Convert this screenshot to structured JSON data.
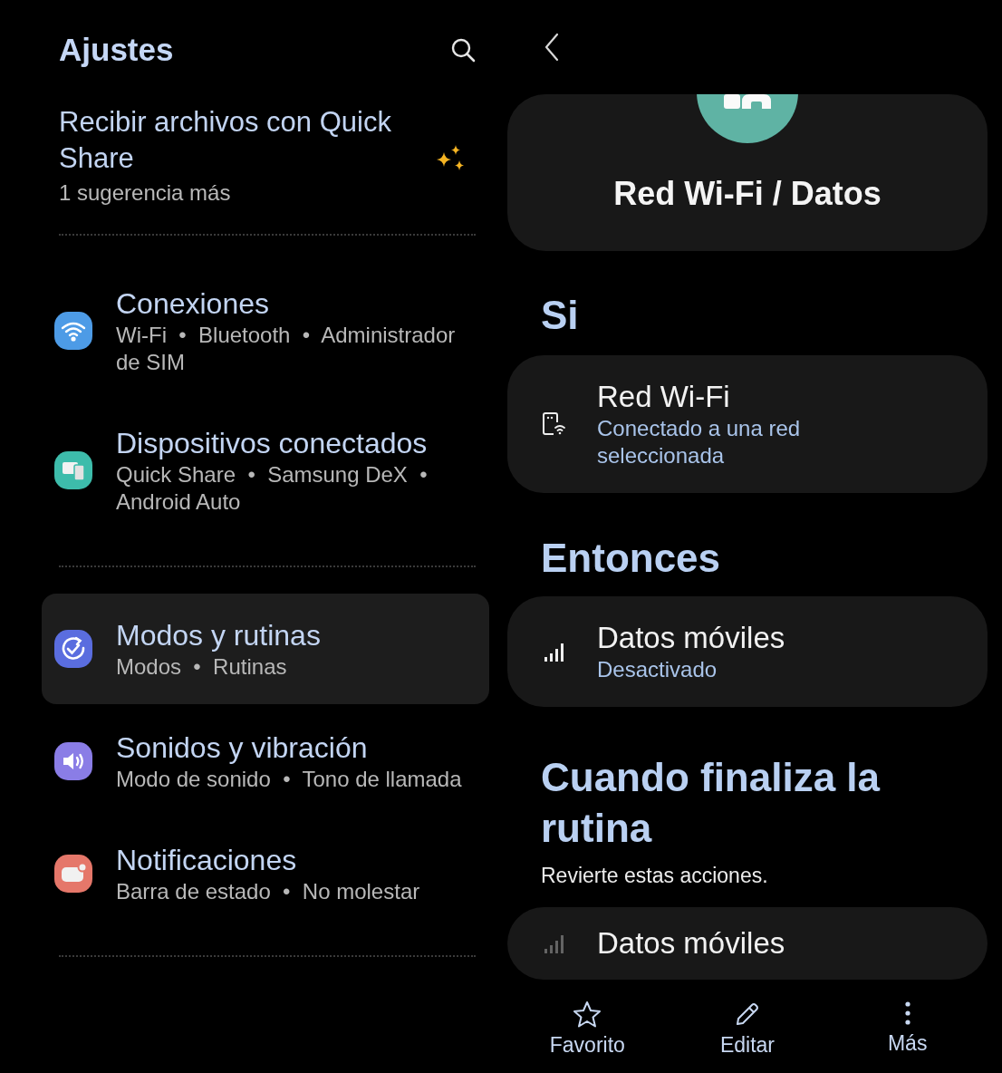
{
  "settings": {
    "title": "Ajustes",
    "suggestion": {
      "title": "Recibir archivos con Quick Share",
      "subtitle": "1 sugerencia más"
    },
    "groups": [
      {
        "items": [
          {
            "kind": "wifi",
            "title": "Conexiones",
            "subtitle": "Wi-Fi  •  Bluetooth  •  Administrador de SIM",
            "color": "#4d9be6",
            "selected": false
          },
          {
            "kind": "devices",
            "title": "Dispositivos conectados",
            "subtitle": "Quick Share  •  Samsung DeX  •  Android Auto",
            "color": "#3dbcab",
            "selected": false
          }
        ]
      },
      {
        "items": [
          {
            "kind": "routine",
            "title": "Modos y rutinas",
            "subtitle": "Modos  •  Rutinas",
            "color": "#5a6ddf",
            "selected": true
          },
          {
            "kind": "sound",
            "title": "Sonidos y vibración",
            "subtitle": "Modo de sonido  •  Tono de llamada",
            "color": "#8a7de6",
            "selected": false
          },
          {
            "kind": "notification",
            "title": "Notificaciones",
            "subtitle": "Barra de estado  •  No molestar",
            "color": "#e5776a",
            "selected": false
          }
        ]
      }
    ]
  },
  "routine": {
    "title": "Red Wi-Fi / Datos",
    "sections": [
      {
        "heading": "Si",
        "items": [
          {
            "kind": "phone-wifi",
            "title": "Red Wi-Fi",
            "subtitle": "Conectado a una red seleccionada",
            "active": true
          }
        ]
      },
      {
        "heading": "Entonces",
        "items": [
          {
            "kind": "signal",
            "title": "Datos móviles",
            "subtitle": "Desactivado",
            "active": true
          }
        ]
      },
      {
        "heading": "Cuando finaliza la rutina",
        "description": "Revierte estas acciones.",
        "items": [
          {
            "kind": "signal",
            "title": "Datos móviles",
            "active": false
          }
        ]
      }
    ]
  },
  "bottom_bar": [
    {
      "kind": "star",
      "label": "Favorito"
    },
    {
      "kind": "pencil",
      "label": "Editar"
    },
    {
      "kind": "more",
      "label": "Más"
    }
  ]
}
